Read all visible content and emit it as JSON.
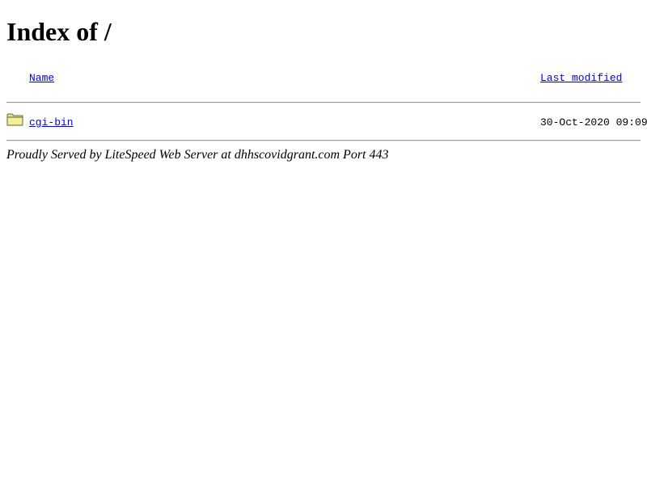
{
  "page": {
    "heading": "Index of /"
  },
  "listing": {
    "columns": {
      "name": "Name",
      "last_modified": "Last modified"
    },
    "rows": [
      {
        "icon": "folder-icon",
        "name": "cgi-bin",
        "last_modified": "30-Oct-2020 09:09"
      }
    ]
  },
  "footer": {
    "text": "Proudly Served by LiteSpeed Web Server at dhhscovidgrant.com Port 443"
  }
}
